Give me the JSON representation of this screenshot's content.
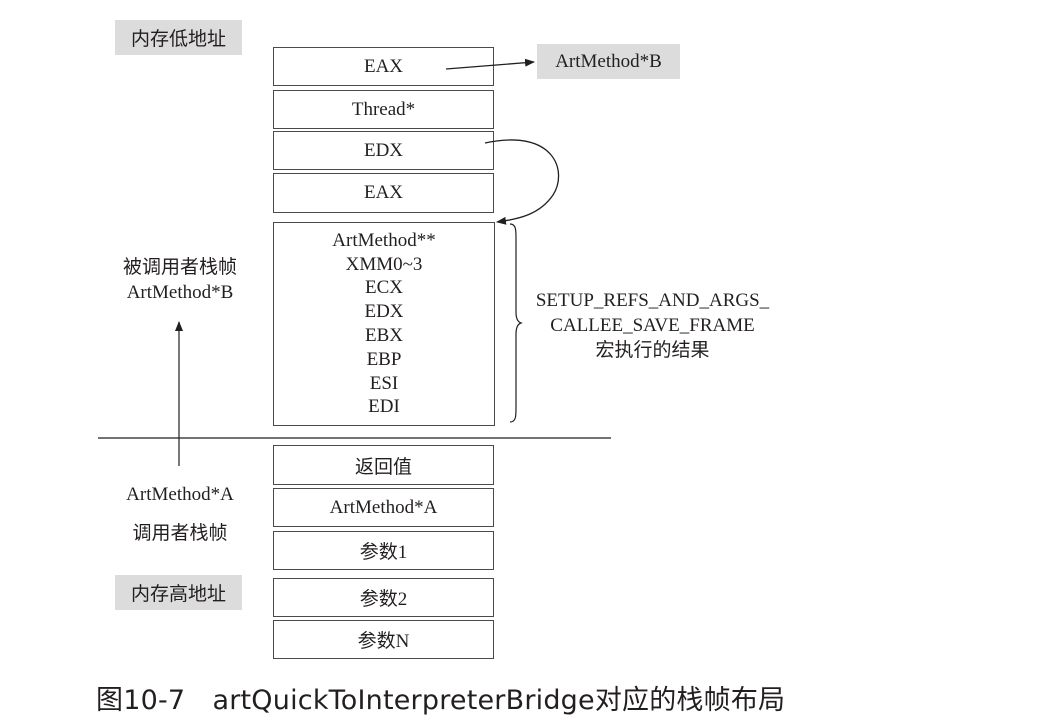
{
  "tags": {
    "low_address": "内存低地址",
    "high_address": "内存高地址",
    "eax_target": "ArtMethod*B"
  },
  "stack_boxes_top": [
    "EAX",
    "Thread*",
    "EDX",
    "EAX"
  ],
  "saved_frame_items": [
    "ArtMethod**",
    "XMM0~3",
    "ECX",
    "EDX",
    "EBX",
    "EBP",
    "ESI",
    "EDI"
  ],
  "stack_boxes_bottom": [
    "返回值",
    "ArtMethod*A",
    "参数1",
    "参数2",
    "参数N"
  ],
  "labels": {
    "callee_frame_line1": "被调用者栈帧",
    "callee_frame_line2": "ArtMethod*B",
    "caller_frame_line1": "ArtMethod*A",
    "caller_frame_line2": "调用者栈帧",
    "macro_line1": "SETUP_REFS_AND_ARGS_",
    "macro_line2": "CALLEE_SAVE_FRAME",
    "macro_line3": "宏执行的结果"
  },
  "caption": "图10-7　artQuickToInterpreterBridge对应的栈帧布局"
}
